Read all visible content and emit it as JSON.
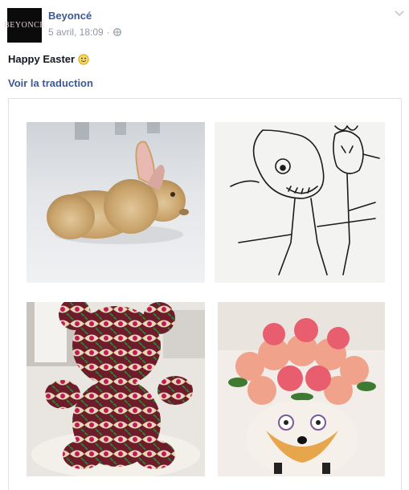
{
  "post": {
    "avatar_text": "BEYONCÉ",
    "author": "Beyoncé",
    "timestamp": "5 avril, 18:09",
    "separator": "·",
    "message": "Happy Easter",
    "translate_link": "Voir la traduction"
  },
  "icons": {
    "privacy": "globe-icon",
    "options": "chevron-down-icon",
    "emoticon": "smiley-icon"
  },
  "photos": [
    {
      "name": "photo-bunny",
      "subject": "straw bunny"
    },
    {
      "name": "photo-drawing",
      "subject": "child drawing"
    },
    {
      "name": "photo-teddy",
      "subject": "fabric teddy bear"
    },
    {
      "name": "photo-flowers",
      "subject": "flower vase"
    }
  ],
  "colors": {
    "link": "#3b5998",
    "meta": "#9197a3",
    "text": "#141823",
    "border": "#dfe0e4"
  }
}
